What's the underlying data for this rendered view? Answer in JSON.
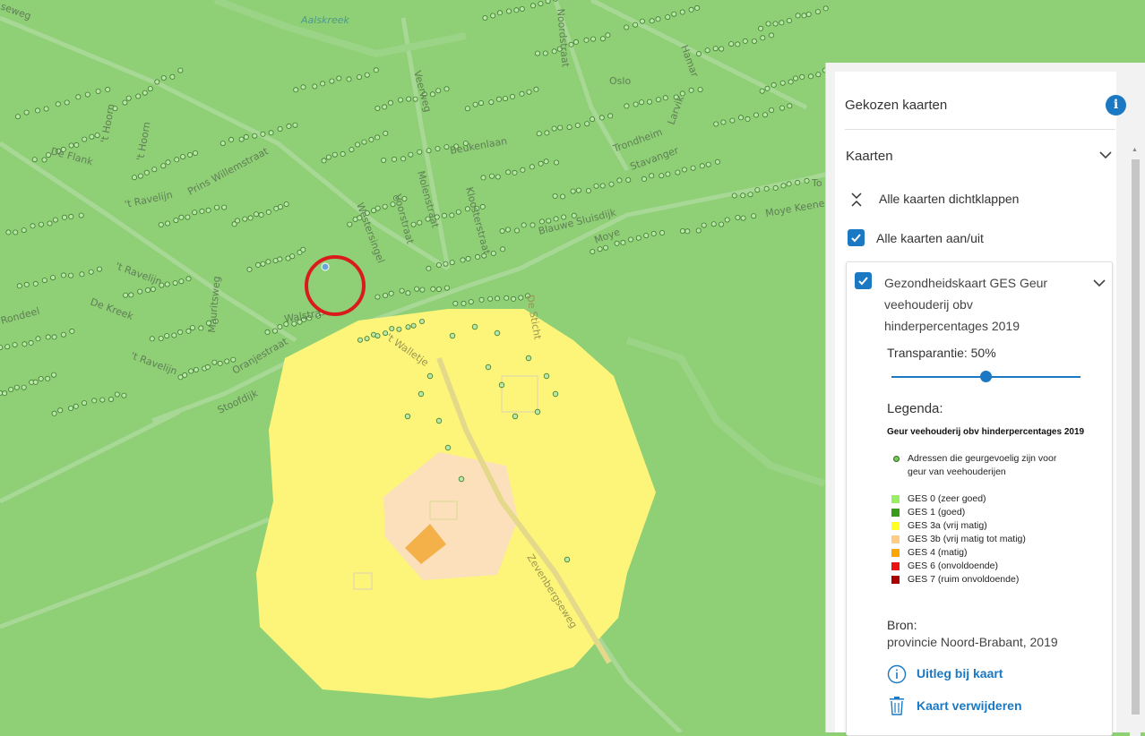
{
  "map": {
    "labels": {
      "aalskreek": "Aalskreek",
      "weg": "seweg",
      "hoorn": "'t Hoorn",
      "hoorn2": "'t Hoorn",
      "de_flank": "De Flank",
      "prins_willemstraat": "Prins Willemstraat",
      "ravelijn1": "'t Ravelijn",
      "ravelijn2": "'t Ravelijn",
      "ravelijn3": "'t Ravelijn",
      "de_kreek": "De Kreek",
      "mauritsweg": "Mauritsweg",
      "walstraat": "Walstra",
      "oranjestraat": "Oranjestraat",
      "stoofdijk": "Stoofdijk",
      "voorstraat": "Voorstraat",
      "molenstraat": "Molenstraat",
      "westersingel": "Westersingel",
      "blauwe_sluisdijk": "Blauwe Sluisdijk",
      "oslo": "Oslo",
      "trondheim": "Trondheim",
      "stavanger": "Stavanger",
      "moye_keene": "Moye Keene",
      "moye": "Moye",
      "de_sticht": "De Sticht",
      "t_walletje": "'t Walletje",
      "zevenbergseweg": "Zevenbergseweg",
      "veerweg": "Veerweg",
      "beukenlaan": "Beukenlaan",
      "noordstraat": "Noordstraat",
      "hamar": "Hamar",
      "larvik": "Larvik",
      "kloosterstraat": "Kloosterstraat",
      "to": "To",
      "rondeel": "Rondeel"
    }
  },
  "panel": {
    "title": "Gekozen kaarten",
    "info_icon": "info-icon",
    "section_title": "Kaarten",
    "collapse_all": "Alle kaarten dichtklappen",
    "toggle_all": "Alle kaarten aan/uit",
    "toggle_all_checked": true,
    "card": {
      "title": "Gezondheidskaart GES Geur veehouderij obv hinderpercentages 2019",
      "checked": true,
      "transparency_label": "Transparantie:",
      "transparency_value": "50%",
      "transparency_fraction": 0.5,
      "legend_title": "Legenda:",
      "legend_subtitle": "Geur veehouderij obv hinderpercentages 2019",
      "dot_label": "Adressen die geurgevoelig zijn voor geur van veehouderijen",
      "legend": [
        {
          "label": "GES 0 (zeer goed)",
          "color": "#99ee66"
        },
        {
          "label": "GES 1 (goed)",
          "color": "#3a9a1a"
        },
        {
          "label": "GES 3a (vrij matig)",
          "color": "#ffff22"
        },
        {
          "label": "GES 3b (vrij matig tot matig)",
          "color": "#ffcc88"
        },
        {
          "label": "GES 4 (matig)",
          "color": "#ffa500"
        },
        {
          "label": "GES 6 (onvoldoende)",
          "color": "#ee1111"
        },
        {
          "label": "GES 7 (ruim onvoldoende)",
          "color": "#aa0000"
        }
      ],
      "source_title": "Bron:",
      "source_text": "provincie Noord-Brabant, 2019",
      "link_explain": "Uitleg bij kaart",
      "link_remove": "Kaart verwijderen"
    }
  },
  "colors": {
    "accent": "#1b78c2",
    "map_green": "#8fcf76",
    "zone_yellow": "#fdf57a",
    "zone_peach": "#fbe0bb",
    "zone_orange": "#f4b14a",
    "marker_red": "#d91b1b"
  }
}
